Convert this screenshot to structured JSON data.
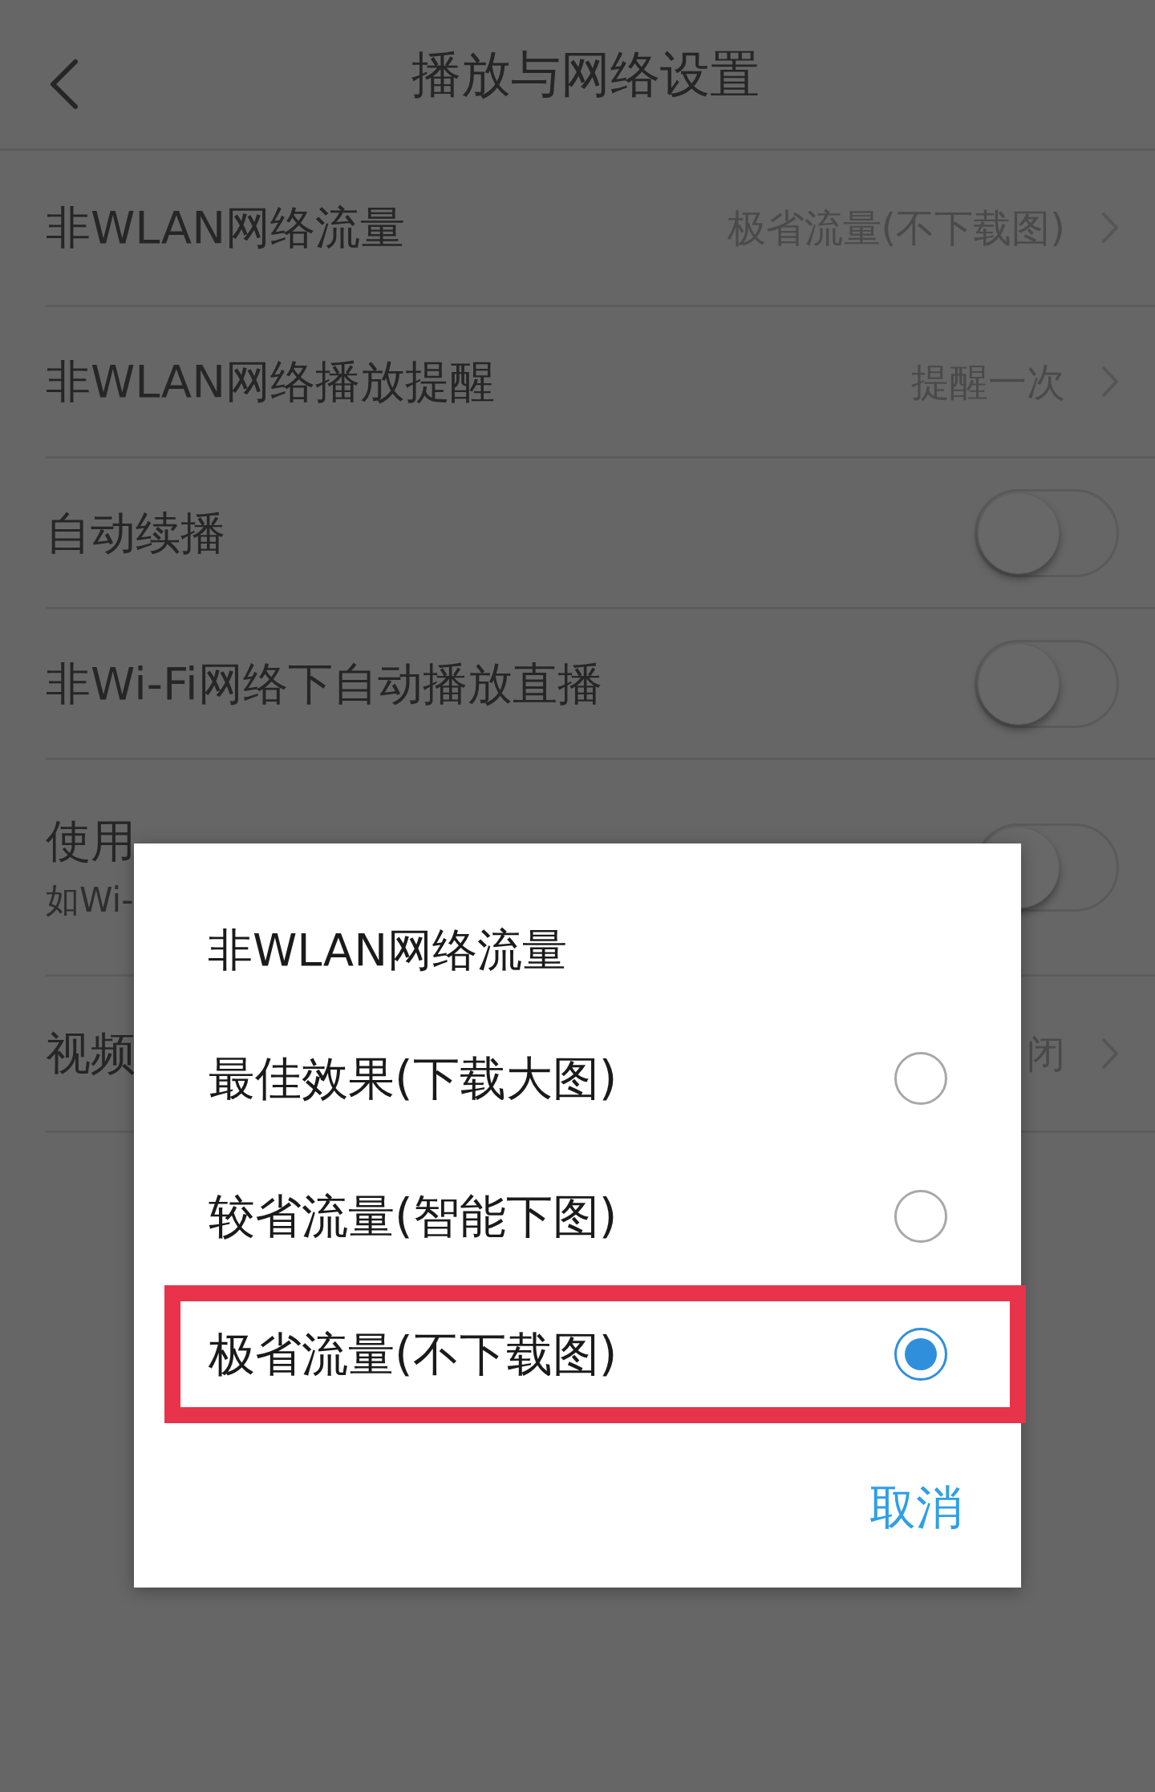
{
  "header": {
    "title": "播放与网络设置"
  },
  "settings": [
    {
      "kind": "select",
      "label": "非WLAN网络流量",
      "value": "极省流量(不下载图)"
    },
    {
      "kind": "select",
      "label": "非WLAN网络播放提醒",
      "value": "提醒一次"
    },
    {
      "kind": "toggle",
      "label": "自动续播",
      "on": false
    },
    {
      "kind": "toggle",
      "label": "非Wi-Fi网络下自动播放直播",
      "on": false
    },
    {
      "kind": "toggle",
      "label": "使用",
      "subtitle": "如Wi-",
      "on": false
    },
    {
      "kind": "select",
      "label": "视频",
      "value": "闭"
    }
  ],
  "dialog": {
    "title": "非WLAN网络流量",
    "options": [
      {
        "label": "最佳效果(下载大图)",
        "selected": false,
        "highlighted": false
      },
      {
        "label": "较省流量(智能下图)",
        "selected": false,
        "highlighted": false
      },
      {
        "label": "极省流量(不下载图)",
        "selected": true,
        "highlighted": true
      }
    ],
    "cancel": "取消"
  }
}
